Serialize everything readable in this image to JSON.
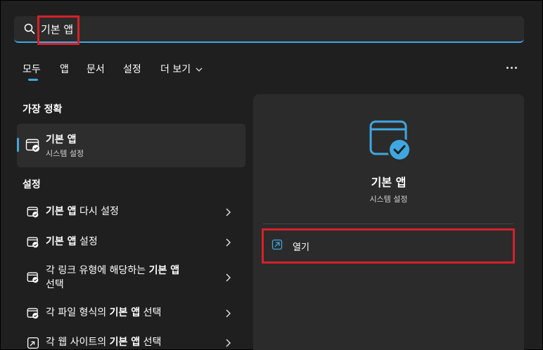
{
  "search": {
    "value": "기본 앱",
    "placeholder": ""
  },
  "tabs": [
    {
      "label": "모두"
    },
    {
      "label": "앱"
    },
    {
      "label": "문서"
    },
    {
      "label": "설정"
    },
    {
      "label": "더 보기"
    }
  ],
  "best_match": {
    "section_title": "가장 정확",
    "title": "기본 앱",
    "subtitle": "시스템 설정"
  },
  "settings": {
    "section_title": "설정",
    "items": [
      {
        "pre": "",
        "bold": "기본 앱",
        "post": " 다시 설정"
      },
      {
        "pre": "",
        "bold": "기본 앱",
        "post": " 설정"
      },
      {
        "pre": "각 링크 유형에 해당하는 ",
        "bold": "기본 앱",
        "post": "",
        "line2": "선택"
      },
      {
        "pre": "각 파일 형식의 ",
        "bold": "기본 앱",
        "post": " 선택"
      },
      {
        "pre": "각 웹 사이트의 ",
        "bold": "기본 앱",
        "post": " 선택"
      }
    ]
  },
  "detail": {
    "title": "기본 앱",
    "subtitle": "시스템 설정",
    "open_label": "열기"
  },
  "colors": {
    "accent": "#3fa7e0",
    "highlight_box": "#d6202a",
    "background": "#1f1f1f",
    "panel": "#2b2b2b"
  }
}
